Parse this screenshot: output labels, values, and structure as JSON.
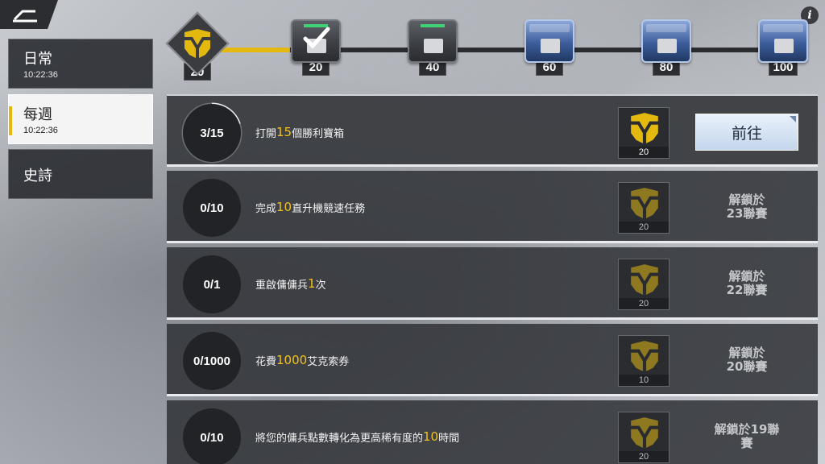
{
  "header": {
    "back_icon": "back-arrow-icon",
    "info_label": "i"
  },
  "tabs": [
    {
      "label": "日常",
      "time": "10:22:36",
      "active": false
    },
    {
      "label": "每週",
      "time": "10:22:36",
      "active": true
    },
    {
      "label": "史詩",
      "time": "",
      "active": false
    }
  ],
  "milestones": [
    {
      "value": "20",
      "type": "emblem",
      "reached": true
    },
    {
      "value": "20",
      "type": "grey-crate",
      "claimed": true
    },
    {
      "value": "40",
      "type": "grey-crate",
      "claimed": false
    },
    {
      "value": "60",
      "type": "blue-crate",
      "claimed": false
    },
    {
      "value": "80",
      "type": "blue-crate",
      "claimed": false
    },
    {
      "value": "100",
      "type": "blue-crate",
      "claimed": false
    }
  ],
  "colors": {
    "accent": "#e3b90f",
    "highlight_text": "#f2c21a"
  },
  "tasks": [
    {
      "progress": "3/15",
      "progress_fraction": 0.2,
      "text_pre": "打開",
      "text_hl": "15",
      "text_post": "個勝利寶箱",
      "reward": "20",
      "action": "前往",
      "locked": false
    },
    {
      "progress": "0/10",
      "text_pre": "完成",
      "text_hl": "10",
      "text_post": " 直升機競速任務",
      "reward": "20",
      "unlock_line1": "解鎖於",
      "unlock_line2": "23聯賽",
      "locked": true
    },
    {
      "progress": "0/1",
      "text_pre": "重啟傭傭兵",
      "text_hl": "1",
      "text_post": "次",
      "reward": "20",
      "unlock_line1": "解鎖於",
      "unlock_line2": "22聯賽",
      "locked": true
    },
    {
      "progress": "0/1000",
      "text_pre": "花費",
      "text_hl": "1000",
      "text_post": " 艾克索券",
      "reward": "10",
      "unlock_line1": "解鎖於",
      "unlock_line2": "20聯賽",
      "locked": true
    },
    {
      "progress": "0/10",
      "text_pre": "將您的傭兵點數轉化為更高稀有度的",
      "text_hl": "10",
      "text_post": "時間",
      "reward": "20",
      "unlock_line1": "解鎖於19聯",
      "unlock_line2": "賽",
      "locked": true
    }
  ]
}
